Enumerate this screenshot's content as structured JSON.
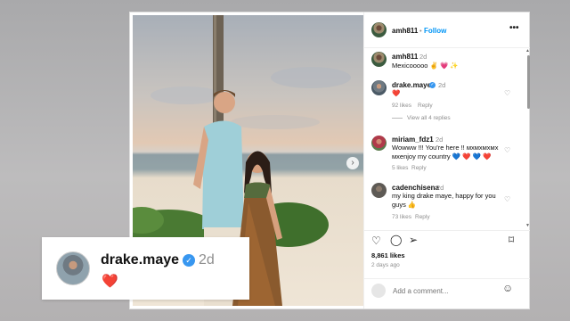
{
  "post": {
    "author": "amh811",
    "follow_label": "Follow",
    "separator": "•",
    "more_label": "•••",
    "next_arrow": "›"
  },
  "comments": [
    {
      "user": "amh811",
      "time": "2d",
      "text": "Mexicooooo ✌️ 💗 ✨"
    },
    {
      "user": "drake.maye",
      "time": "2d",
      "verified": true,
      "text": "❤️",
      "likes": "92 likes",
      "reply": "Reply",
      "view_replies": "View all 4 replies"
    },
    {
      "user": "miriam_fdz1",
      "time": "2d",
      "text_line1": "Wowww !!! You're here !! ᴍxᴍxᴍxᴍx",
      "text_line2": "ᴍxenjoy my country 💙 ❤️ 💙 ❤️",
      "likes": "5 likes",
      "reply": "Reply"
    },
    {
      "user": "cadenchisena",
      "time": "2d",
      "text_line1": "my king drake maye, happy for you",
      "text_line2": "guys 👍",
      "likes": "73 likes",
      "reply": "Reply"
    }
  ],
  "actions": {
    "like_icon": "heart-outline-icon",
    "comment_icon": "comment-icon",
    "share_icon": "send-icon",
    "save_icon": "bookmark-icon"
  },
  "stats": {
    "likes": "8,861 likes",
    "posted": "2 days ago"
  },
  "add_comment": {
    "placeholder": "Add a comment..."
  },
  "overlay": {
    "user": "drake.maye",
    "verified": true,
    "time": "2d",
    "text": "❤️"
  },
  "colors": {
    "accent": "#0095f6",
    "verified": "#3897f0",
    "heart": "#e0245e"
  }
}
